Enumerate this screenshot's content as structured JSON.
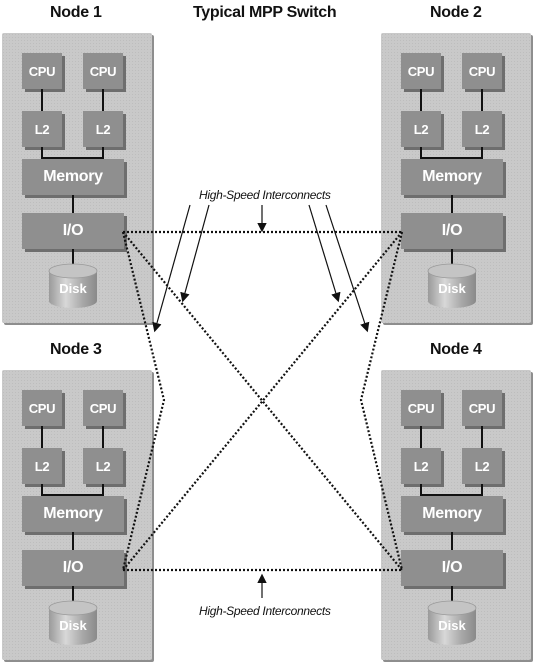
{
  "diagram": {
    "title": "Typical MPP Switch",
    "interconnect_label_top": "High-Speed Interconnects",
    "interconnect_label_bottom": "High-Speed Interconnects",
    "nodes": [
      {
        "name": "Node 1",
        "cpu": [
          "CPU",
          "CPU"
        ],
        "cache": [
          "L2",
          "L2"
        ],
        "memory": "Memory",
        "io": "I/O",
        "disk": "Disk"
      },
      {
        "name": "Node 2",
        "cpu": [
          "CPU",
          "CPU"
        ],
        "cache": [
          "L2",
          "L2"
        ],
        "memory": "Memory",
        "io": "I/O",
        "disk": "Disk"
      },
      {
        "name": "Node 3",
        "cpu": [
          "CPU",
          "CPU"
        ],
        "cache": [
          "L2",
          "L2"
        ],
        "memory": "Memory",
        "io": "I/O",
        "disk": "Disk"
      },
      {
        "name": "Node 4",
        "cpu": [
          "CPU",
          "CPU"
        ],
        "cache": [
          "L2",
          "L2"
        ],
        "memory": "Memory",
        "io": "I/O",
        "disk": "Disk"
      }
    ],
    "links": [
      {
        "from": "Node 1",
        "to": "Node 2"
      },
      {
        "from": "Node 3",
        "to": "Node 4"
      },
      {
        "from": "Node 1",
        "to": "Node 4"
      },
      {
        "from": "Node 2",
        "to": "Node 3"
      },
      {
        "from": "Node 1",
        "to": "Node 3"
      },
      {
        "from": "Node 2",
        "to": "Node 4"
      }
    ],
    "colors": {
      "panel": "#c9c9c9",
      "component": "#8f8f8f",
      "line": "#111111"
    }
  }
}
